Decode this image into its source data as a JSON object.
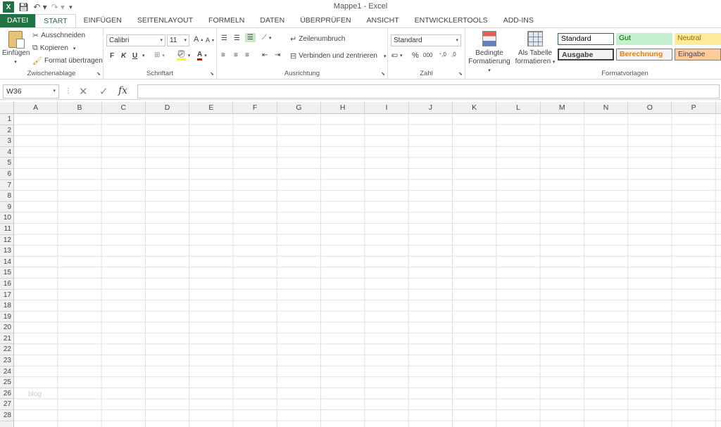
{
  "window": {
    "title": "Mappe1 - Excel",
    "app_icon": "X"
  },
  "tabs": [
    {
      "label": "DATEI"
    },
    {
      "label": "START"
    },
    {
      "label": "EINFÜGEN"
    },
    {
      "label": "SEITENLAYOUT"
    },
    {
      "label": "FORMELN"
    },
    {
      "label": "DATEN"
    },
    {
      "label": "ÜBERPRÜFEN"
    },
    {
      "label": "ANSICHT"
    },
    {
      "label": "ENTWICKLERTOOLS"
    },
    {
      "label": "ADD-INS"
    }
  ],
  "clipboard": {
    "paste": "Einfügen",
    "cut": "Ausschneiden",
    "copy": "Kopieren",
    "format_painter": "Format übertragen",
    "label": "Zwischenablage"
  },
  "font": {
    "name": "Calibri",
    "size": "11",
    "bold": "F",
    "italic": "K",
    "underline": "U",
    "label": "Schriftart"
  },
  "alignment": {
    "wrap": "Zeilenumbruch",
    "merge": "Verbinden und zentrieren",
    "label": "Ausrichtung"
  },
  "number": {
    "format": "Standard",
    "percent": "%",
    "thousands": "000",
    "label": "Zahl"
  },
  "styles": {
    "conditional_1": "Bedingte",
    "conditional_2": "Formatierung",
    "table_1": "Als Tabelle",
    "table_2": "formatieren",
    "cells": [
      {
        "label": "Standard"
      },
      {
        "label": "Gut"
      },
      {
        "label": "Neutral"
      },
      {
        "label": "Ausgabe"
      },
      {
        "label": "Berechnung"
      },
      {
        "label": "Eingabe"
      }
    ],
    "label": "Formatvorlagen"
  },
  "formula_bar": {
    "name_box": "W36",
    "fx": "fx"
  },
  "columns": [
    "A",
    "B",
    "C",
    "D",
    "E",
    "F",
    "G",
    "H",
    "I",
    "J",
    "K",
    "L",
    "M",
    "N",
    "O",
    "P"
  ],
  "rows": [
    "1",
    "2",
    "3",
    "4",
    "5",
    "6",
    "7",
    "8",
    "9",
    "10",
    "11",
    "12",
    "13",
    "14",
    "15",
    "16",
    "17",
    "18",
    "19",
    "20",
    "21",
    "22",
    "23",
    "24",
    "25",
    "26",
    "27",
    "28"
  ],
  "watermark": "blog",
  "colors": {
    "excel_green": "#217346",
    "gut_bg": "#c6efce",
    "neutral_bg": "#ffeb9c",
    "eingabe_bg": "#ffcc99"
  }
}
